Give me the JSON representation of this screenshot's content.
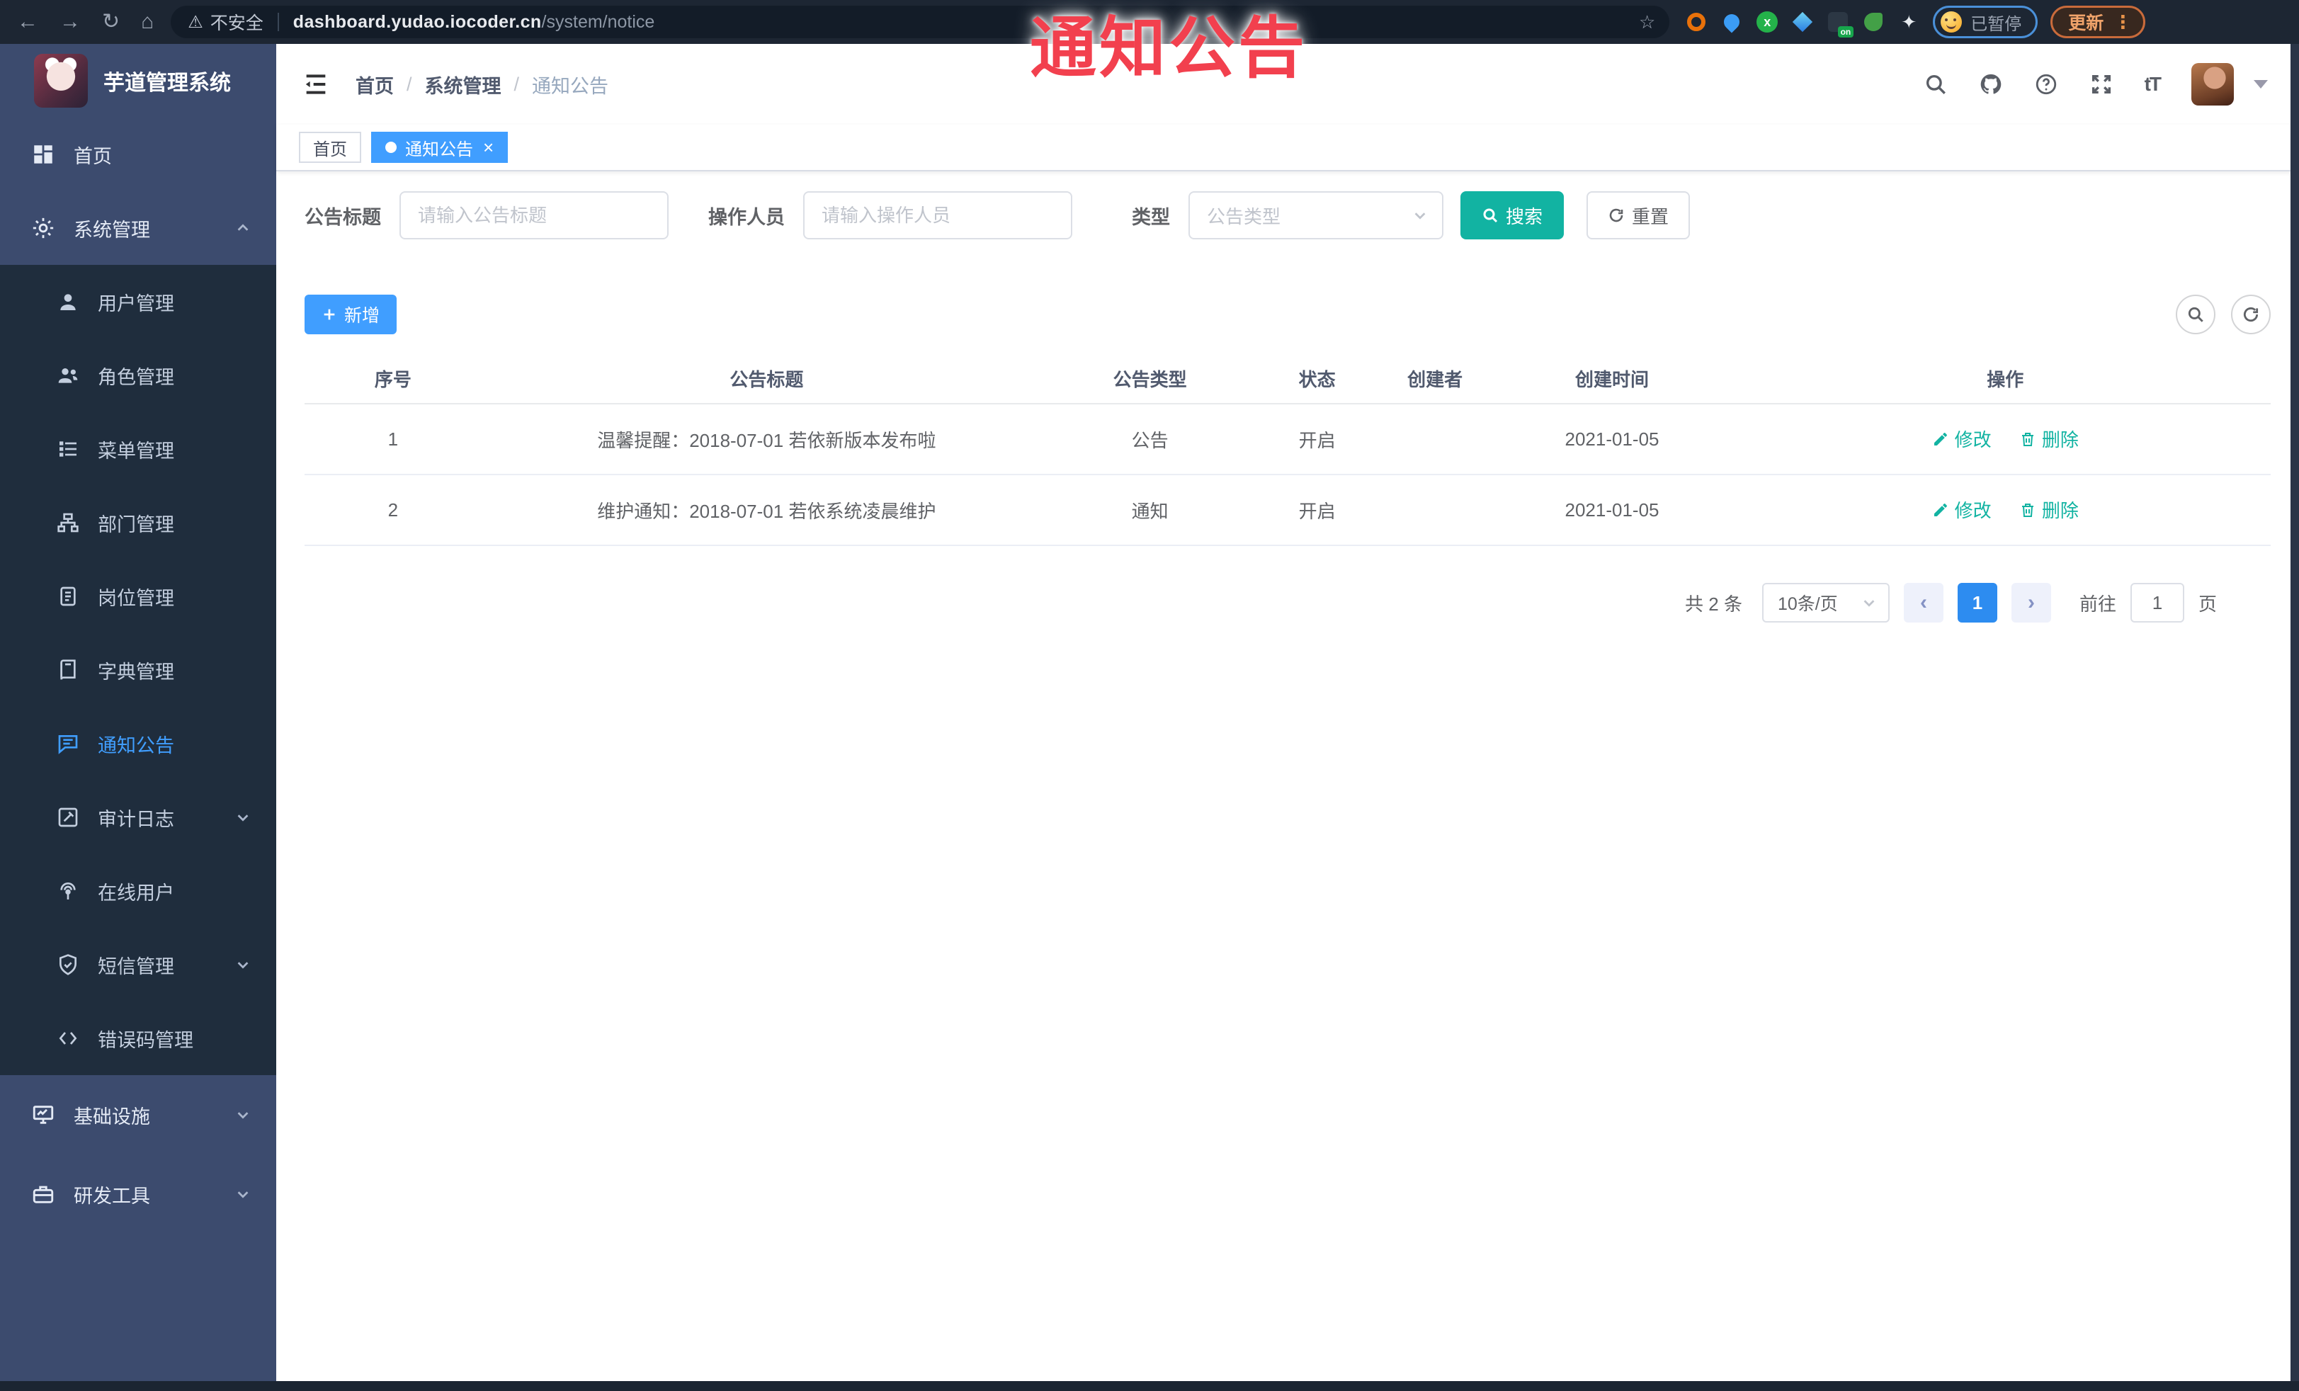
{
  "overlay": {
    "title": "通知公告"
  },
  "browser": {
    "security_text": "不安全",
    "url_host": "dashboard.yudao.iocoder.cn",
    "url_path": "/system/notice",
    "paused_badge": "已暂停",
    "update_button": "更新"
  },
  "sidebar": {
    "app_title": "芋道管理系统",
    "home": {
      "label": "首页"
    },
    "system": {
      "label": "系统管理"
    },
    "system_children": [
      {
        "label": "用户管理"
      },
      {
        "label": "角色管理"
      },
      {
        "label": "菜单管理"
      },
      {
        "label": "部门管理"
      },
      {
        "label": "岗位管理"
      },
      {
        "label": "字典管理"
      },
      {
        "label": "通知公告"
      },
      {
        "label": "审计日志"
      },
      {
        "label": "在线用户"
      },
      {
        "label": "短信管理"
      },
      {
        "label": "错误码管理"
      }
    ],
    "infra": {
      "label": "基础设施"
    },
    "dev": {
      "label": "研发工具"
    }
  },
  "header": {
    "breadcrumb": [
      "首页",
      "系统管理",
      "通知公告"
    ]
  },
  "tabs": [
    {
      "label": "首页"
    },
    {
      "label": "通知公告"
    }
  ],
  "filters": {
    "title_label": "公告标题",
    "title_placeholder": "请输入公告标题",
    "operator_label": "操作人员",
    "operator_placeholder": "请输入操作人员",
    "type_label": "类型",
    "type_placeholder": "公告类型",
    "search_label": "搜索",
    "reset_label": "重置"
  },
  "toolbar": {
    "add_label": "新增"
  },
  "table": {
    "columns": [
      "序号",
      "公告标题",
      "公告类型",
      "状态",
      "创建者",
      "创建时间",
      "操作"
    ],
    "rows": [
      {
        "no": "1",
        "title": "温馨提醒：2018-07-01 若依新版本发布啦",
        "type": "公告",
        "status": "开启",
        "creator": "",
        "created": "2021-01-05",
        "edit_label": "修改",
        "delete_label": "删除"
      },
      {
        "no": "2",
        "title": "维护通知：2018-07-01 若依系统凌晨维护",
        "type": "通知",
        "status": "开启",
        "creator": "",
        "created": "2021-01-05",
        "edit_label": "修改",
        "delete_label": "删除"
      }
    ]
  },
  "pagination": {
    "total_text": "共 2 条",
    "page_size": "10条/页",
    "prev": "‹",
    "current_page": "1",
    "next": "›",
    "goto_label": "前往",
    "goto_value": "1",
    "unit_label": "页"
  },
  "colors": {
    "accent_blue": "#409eff",
    "theme_teal": "#12b3a2",
    "overlay_red": "#f2404e",
    "sidebar_bg": "#3c4b6e",
    "submenu_bg": "#1f2d3d"
  }
}
